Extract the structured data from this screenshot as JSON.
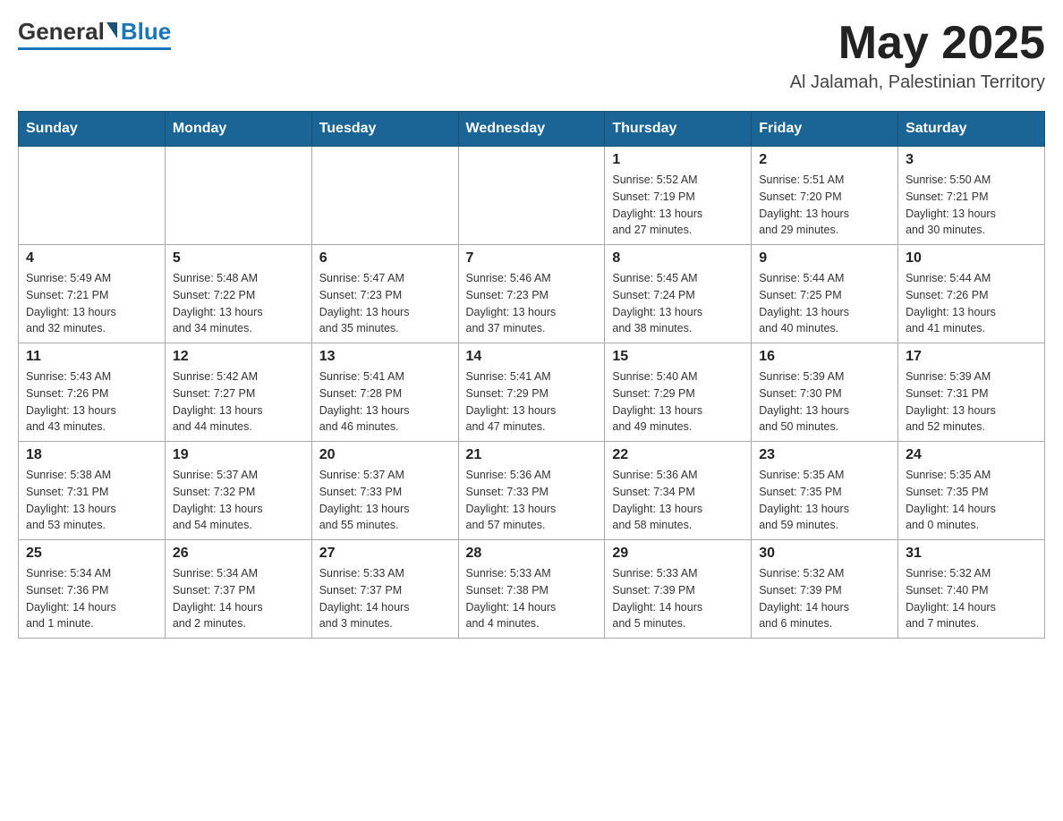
{
  "header": {
    "logo": {
      "general": "General",
      "blue": "Blue"
    },
    "title": "May 2025",
    "subtitle": "Al Jalamah, Palestinian Territory"
  },
  "days_of_week": [
    "Sunday",
    "Monday",
    "Tuesday",
    "Wednesday",
    "Thursday",
    "Friday",
    "Saturday"
  ],
  "weeks": [
    [
      {
        "day": "",
        "info": ""
      },
      {
        "day": "",
        "info": ""
      },
      {
        "day": "",
        "info": ""
      },
      {
        "day": "",
        "info": ""
      },
      {
        "day": "1",
        "info": "Sunrise: 5:52 AM\nSunset: 7:19 PM\nDaylight: 13 hours\nand 27 minutes."
      },
      {
        "day": "2",
        "info": "Sunrise: 5:51 AM\nSunset: 7:20 PM\nDaylight: 13 hours\nand 29 minutes."
      },
      {
        "day": "3",
        "info": "Sunrise: 5:50 AM\nSunset: 7:21 PM\nDaylight: 13 hours\nand 30 minutes."
      }
    ],
    [
      {
        "day": "4",
        "info": "Sunrise: 5:49 AM\nSunset: 7:21 PM\nDaylight: 13 hours\nand 32 minutes."
      },
      {
        "day": "5",
        "info": "Sunrise: 5:48 AM\nSunset: 7:22 PM\nDaylight: 13 hours\nand 34 minutes."
      },
      {
        "day": "6",
        "info": "Sunrise: 5:47 AM\nSunset: 7:23 PM\nDaylight: 13 hours\nand 35 minutes."
      },
      {
        "day": "7",
        "info": "Sunrise: 5:46 AM\nSunset: 7:23 PM\nDaylight: 13 hours\nand 37 minutes."
      },
      {
        "day": "8",
        "info": "Sunrise: 5:45 AM\nSunset: 7:24 PM\nDaylight: 13 hours\nand 38 minutes."
      },
      {
        "day": "9",
        "info": "Sunrise: 5:44 AM\nSunset: 7:25 PM\nDaylight: 13 hours\nand 40 minutes."
      },
      {
        "day": "10",
        "info": "Sunrise: 5:44 AM\nSunset: 7:26 PM\nDaylight: 13 hours\nand 41 minutes."
      }
    ],
    [
      {
        "day": "11",
        "info": "Sunrise: 5:43 AM\nSunset: 7:26 PM\nDaylight: 13 hours\nand 43 minutes."
      },
      {
        "day": "12",
        "info": "Sunrise: 5:42 AM\nSunset: 7:27 PM\nDaylight: 13 hours\nand 44 minutes."
      },
      {
        "day": "13",
        "info": "Sunrise: 5:41 AM\nSunset: 7:28 PM\nDaylight: 13 hours\nand 46 minutes."
      },
      {
        "day": "14",
        "info": "Sunrise: 5:41 AM\nSunset: 7:29 PM\nDaylight: 13 hours\nand 47 minutes."
      },
      {
        "day": "15",
        "info": "Sunrise: 5:40 AM\nSunset: 7:29 PM\nDaylight: 13 hours\nand 49 minutes."
      },
      {
        "day": "16",
        "info": "Sunrise: 5:39 AM\nSunset: 7:30 PM\nDaylight: 13 hours\nand 50 minutes."
      },
      {
        "day": "17",
        "info": "Sunrise: 5:39 AM\nSunset: 7:31 PM\nDaylight: 13 hours\nand 52 minutes."
      }
    ],
    [
      {
        "day": "18",
        "info": "Sunrise: 5:38 AM\nSunset: 7:31 PM\nDaylight: 13 hours\nand 53 minutes."
      },
      {
        "day": "19",
        "info": "Sunrise: 5:37 AM\nSunset: 7:32 PM\nDaylight: 13 hours\nand 54 minutes."
      },
      {
        "day": "20",
        "info": "Sunrise: 5:37 AM\nSunset: 7:33 PM\nDaylight: 13 hours\nand 55 minutes."
      },
      {
        "day": "21",
        "info": "Sunrise: 5:36 AM\nSunset: 7:33 PM\nDaylight: 13 hours\nand 57 minutes."
      },
      {
        "day": "22",
        "info": "Sunrise: 5:36 AM\nSunset: 7:34 PM\nDaylight: 13 hours\nand 58 minutes."
      },
      {
        "day": "23",
        "info": "Sunrise: 5:35 AM\nSunset: 7:35 PM\nDaylight: 13 hours\nand 59 minutes."
      },
      {
        "day": "24",
        "info": "Sunrise: 5:35 AM\nSunset: 7:35 PM\nDaylight: 14 hours\nand 0 minutes."
      }
    ],
    [
      {
        "day": "25",
        "info": "Sunrise: 5:34 AM\nSunset: 7:36 PM\nDaylight: 14 hours\nand 1 minute."
      },
      {
        "day": "26",
        "info": "Sunrise: 5:34 AM\nSunset: 7:37 PM\nDaylight: 14 hours\nand 2 minutes."
      },
      {
        "day": "27",
        "info": "Sunrise: 5:33 AM\nSunset: 7:37 PM\nDaylight: 14 hours\nand 3 minutes."
      },
      {
        "day": "28",
        "info": "Sunrise: 5:33 AM\nSunset: 7:38 PM\nDaylight: 14 hours\nand 4 minutes."
      },
      {
        "day": "29",
        "info": "Sunrise: 5:33 AM\nSunset: 7:39 PM\nDaylight: 14 hours\nand 5 minutes."
      },
      {
        "day": "30",
        "info": "Sunrise: 5:32 AM\nSunset: 7:39 PM\nDaylight: 14 hours\nand 6 minutes."
      },
      {
        "day": "31",
        "info": "Sunrise: 5:32 AM\nSunset: 7:40 PM\nDaylight: 14 hours\nand 7 minutes."
      }
    ]
  ]
}
